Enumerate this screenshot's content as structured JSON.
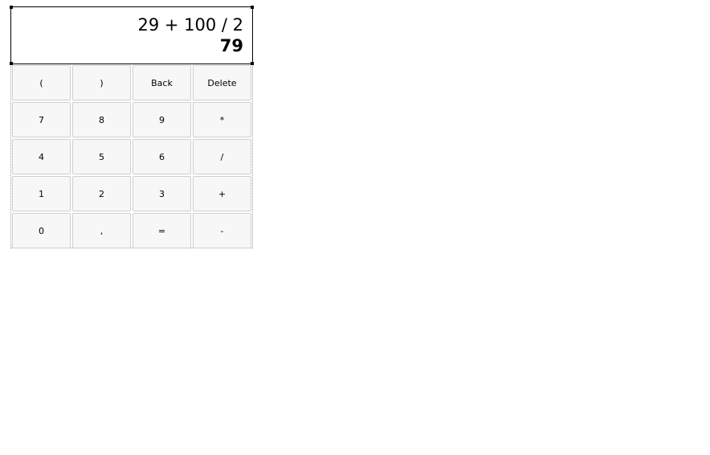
{
  "display": {
    "expression": "29 + 100 / 2",
    "result": "79"
  },
  "keys": [
    {
      "label": "(",
      "name": "open-paren-button"
    },
    {
      "label": ")",
      "name": "close-paren-button"
    },
    {
      "label": "Back",
      "name": "back-button"
    },
    {
      "label": "Delete",
      "name": "delete-button"
    },
    {
      "label": "7",
      "name": "digit-7-button"
    },
    {
      "label": "8",
      "name": "digit-8-button"
    },
    {
      "label": "9",
      "name": "digit-9-button"
    },
    {
      "label": "*",
      "name": "multiply-button"
    },
    {
      "label": "4",
      "name": "digit-4-button"
    },
    {
      "label": "5",
      "name": "digit-5-button"
    },
    {
      "label": "6",
      "name": "digit-6-button"
    },
    {
      "label": "/",
      "name": "divide-button"
    },
    {
      "label": "1",
      "name": "digit-1-button"
    },
    {
      "label": "2",
      "name": "digit-2-button"
    },
    {
      "label": "3",
      "name": "digit-3-button"
    },
    {
      "label": "+",
      "name": "add-button"
    },
    {
      "label": "0",
      "name": "digit-0-button"
    },
    {
      "label": ",",
      "name": "decimal-comma-button"
    },
    {
      "label": "=",
      "name": "equals-button"
    },
    {
      "label": "-",
      "name": "subtract-button"
    }
  ]
}
